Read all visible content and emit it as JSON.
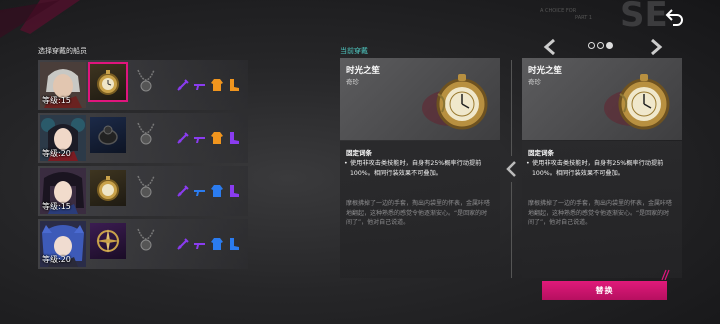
{
  "header": {
    "deco_text_line1": "A CHOICE FOR",
    "deco_text_line2": "PART 1"
  },
  "crew_panel": {
    "title": "选择穿戴的船员",
    "members": [
      {
        "level_label": "等级:15",
        "portrait": "grey-haired-man-portrait",
        "equip_icon": "pocket-watch-icon",
        "equip_rarity": "gold",
        "selected": true
      },
      {
        "level_label": "等级:20",
        "portrait": "dark-haired-girl-portrait",
        "equip_icon": "black-ring-icon",
        "equip_rarity": "blue",
        "selected": false
      },
      {
        "level_label": "等级:15",
        "portrait": "twin-tail-girl-portrait",
        "equip_icon": "pocket-watch-icon",
        "equip_rarity": "gold",
        "selected": false
      },
      {
        "level_label": "等级:20",
        "portrait": "blue-haired-girl-portrait",
        "equip_icon": "compass-icon",
        "equip_rarity": "purple",
        "selected": false
      }
    ]
  },
  "current": {
    "section_label": "当前穿戴",
    "name": "时光之笙",
    "type": "奇珍",
    "fixed_label": "固定词条",
    "effect": "使用非攻击类技能时，自身有25%概率行动提前100%。相同行装效果不可叠加。",
    "lore": "摩根拂掉了一边的手套，掏出内袋里的怀表，金属咔嗒地翻起，这种熟悉的感觉令他逐渐安心。“是回家的时间了”，他对自己说道。"
  },
  "compare": {
    "name": "时光之笙",
    "type": "奇珍",
    "fixed_label": "固定词条",
    "effect": "使用非攻击类技能时，自身有25%概率行动提前100%。相同行装效果不可叠加。",
    "lore": "摩根拂掉了一边的手套，掏出内袋里的怀表，金属咔嗒地翻起，这种熟悉的感觉令他逐渐安心。“是回家的时间了”，他对自己说道。"
  },
  "pager": {
    "total": 3,
    "active": 3
  },
  "replace_button_label": "替换",
  "colors": {
    "accent": "#e0157d",
    "teal": "#4fc9c2",
    "gold": "#c9a24a",
    "mini_purple": "#8a3cf0",
    "mini_blue": "#2b7cf0",
    "mini_orange": "#f0951e"
  }
}
